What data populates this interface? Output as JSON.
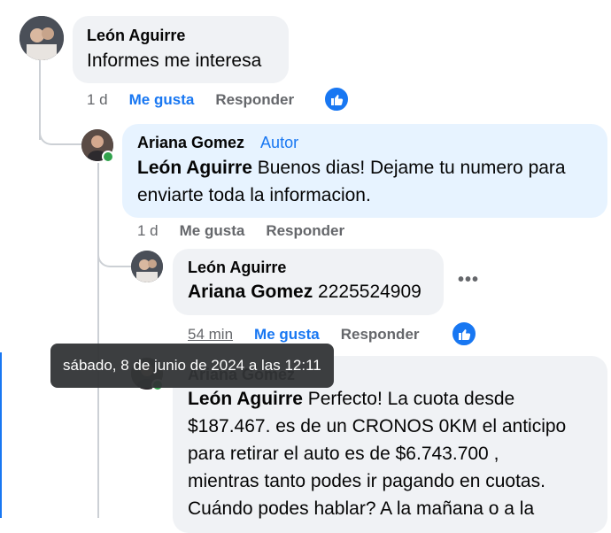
{
  "comments": [
    {
      "author": "León Aguirre",
      "badge": "",
      "mention": "",
      "text": "Informes me interesa",
      "time": "1 d",
      "like_label": "Me gusta",
      "reply_label": "Responder",
      "liked": true
    },
    {
      "author": "Ariana Gomez",
      "badge": "Autor",
      "mention": "León Aguirre",
      "text_line1": " Buenos dias! Dejame tu numero para",
      "text_line2": "enviarte toda la informacion.",
      "time": "1 d",
      "like_label": "Me gusta",
      "reply_label": "Responder",
      "liked": false
    },
    {
      "author": "León Aguirre",
      "mention": "Ariana Gomez",
      "text": " 2225524909",
      "time": "54 min",
      "like_label": "Me gusta",
      "reply_label": "Responder",
      "liked": true,
      "more_icon": "more-options-icon"
    },
    {
      "author": "Ariana Gomez",
      "mention": "León Aguirre",
      "text_line1": " Perfecto! La cuota desde",
      "text_line2": "$187.467. es de un CRONOS 0KM el anticipo",
      "text_line3": "para retirar el auto es de $6.743.700 ,",
      "text_line4": "mientras tanto podes ir pagando en cuotas.",
      "text_line5": "Cuándo podes hablar? A la mañana o a la"
    }
  ],
  "tooltip": "sábado, 8 de junio de 2024 a las 12:11",
  "colors": {
    "accent": "#1877f2",
    "bubble_gray": "#f0f2f5",
    "bubble_author": "#e7f3ff",
    "online": "#31a24c"
  }
}
